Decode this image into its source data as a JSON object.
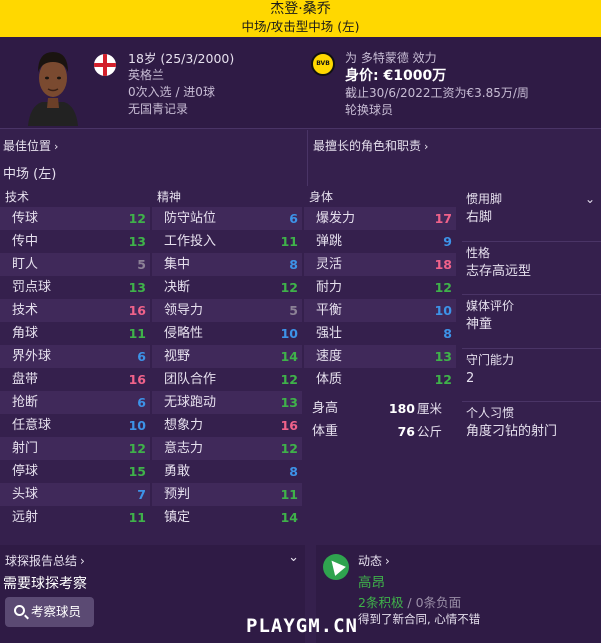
{
  "header": {
    "name": "杰登·桑乔",
    "position": "中场/攻击型中场 (左)"
  },
  "profile": {
    "age_dob": "18岁 (25/3/2000)",
    "nationality": "英格兰",
    "caps_goals": "0次入选 / 进0球",
    "youth_record": "无国青记录",
    "club_line": "为 多特蒙德 效力",
    "value_label": "身价:",
    "value": "€1000万",
    "contract": "截止30/6/2022工资为€3.85万/周",
    "status": "轮换球员"
  },
  "best_position": {
    "title": "最佳位置",
    "value": "中场 (左)"
  },
  "best_role": {
    "title": "最擅长的角色和职责"
  },
  "technical": {
    "title": "技术",
    "rows": [
      {
        "label": "传球",
        "value": "12",
        "color": "green"
      },
      {
        "label": "传中",
        "value": "13",
        "color": "green"
      },
      {
        "label": "盯人",
        "value": "5",
        "color": "grey"
      },
      {
        "label": "罚点球",
        "value": "13",
        "color": "green"
      },
      {
        "label": "技术",
        "value": "16",
        "color": "pink"
      },
      {
        "label": "角球",
        "value": "11",
        "color": "green"
      },
      {
        "label": "界外球",
        "value": "6",
        "color": "blue"
      },
      {
        "label": "盘带",
        "value": "16",
        "color": "pink"
      },
      {
        "label": "抢断",
        "value": "6",
        "color": "blue"
      },
      {
        "label": "任意球",
        "value": "10",
        "color": "blue"
      },
      {
        "label": "射门",
        "value": "12",
        "color": "green"
      },
      {
        "label": "停球",
        "value": "15",
        "color": "green"
      },
      {
        "label": "头球",
        "value": "7",
        "color": "blue"
      },
      {
        "label": "远射",
        "value": "11",
        "color": "green"
      }
    ]
  },
  "mental": {
    "title": "精神",
    "rows": [
      {
        "label": "防守站位",
        "value": "6",
        "color": "blue"
      },
      {
        "label": "工作投入",
        "value": "11",
        "color": "green"
      },
      {
        "label": "集中",
        "value": "8",
        "color": "blue"
      },
      {
        "label": "决断",
        "value": "12",
        "color": "green"
      },
      {
        "label": "领导力",
        "value": "5",
        "color": "grey"
      },
      {
        "label": "侵略性",
        "value": "10",
        "color": "blue"
      },
      {
        "label": "视野",
        "value": "14",
        "color": "green"
      },
      {
        "label": "团队合作",
        "value": "12",
        "color": "green"
      },
      {
        "label": "无球跑动",
        "value": "13",
        "color": "green"
      },
      {
        "label": "想象力",
        "value": "16",
        "color": "pink"
      },
      {
        "label": "意志力",
        "value": "12",
        "color": "green"
      },
      {
        "label": "勇敢",
        "value": "8",
        "color": "blue"
      },
      {
        "label": "预判",
        "value": "11",
        "color": "green"
      },
      {
        "label": "镇定",
        "value": "14",
        "color": "green"
      }
    ]
  },
  "physical": {
    "title": "身体",
    "rows": [
      {
        "label": "爆发力",
        "value": "17",
        "color": "pink"
      },
      {
        "label": "弹跳",
        "value": "9",
        "color": "blue"
      },
      {
        "label": "灵活",
        "value": "18",
        "color": "pink"
      },
      {
        "label": "耐力",
        "value": "12",
        "color": "green"
      },
      {
        "label": "平衡",
        "value": "10",
        "color": "blue"
      },
      {
        "label": "强壮",
        "value": "8",
        "color": "blue"
      },
      {
        "label": "速度",
        "value": "13",
        "color": "green"
      },
      {
        "label": "体质",
        "value": "12",
        "color": "green"
      }
    ],
    "height_label": "身高",
    "height_value": "180",
    "height_unit": "厘米",
    "weight_label": "体重",
    "weight_value": "76",
    "weight_unit": "公斤"
  },
  "sidebar": {
    "items": [
      {
        "title": "惯用脚",
        "value": "右脚"
      },
      {
        "title": "性格",
        "value": "志存高远型"
      },
      {
        "title": "媒体评价",
        "value": "神童"
      },
      {
        "title": "守门能力",
        "value": "2"
      },
      {
        "title": "个人习惯",
        "value": "角度刁钻的射门"
      }
    ]
  },
  "scout": {
    "title": "球探报告总结",
    "need": "需要球探考察",
    "button": "考察球员"
  },
  "dynamics": {
    "title": "动态",
    "morale": "高昂",
    "positive": "2条积极",
    "separator": " / ",
    "negative": "0条负面",
    "detail": "得到了新合同, 心情不错"
  },
  "watermark": "PLAYGM.CN",
  "colors": {
    "header_bg": "#ffd800",
    "panel_bg": "#35204d",
    "green": "#3fb24a",
    "pink": "#f0628a",
    "blue": "#3d93e8",
    "grey": "#8c8196"
  }
}
